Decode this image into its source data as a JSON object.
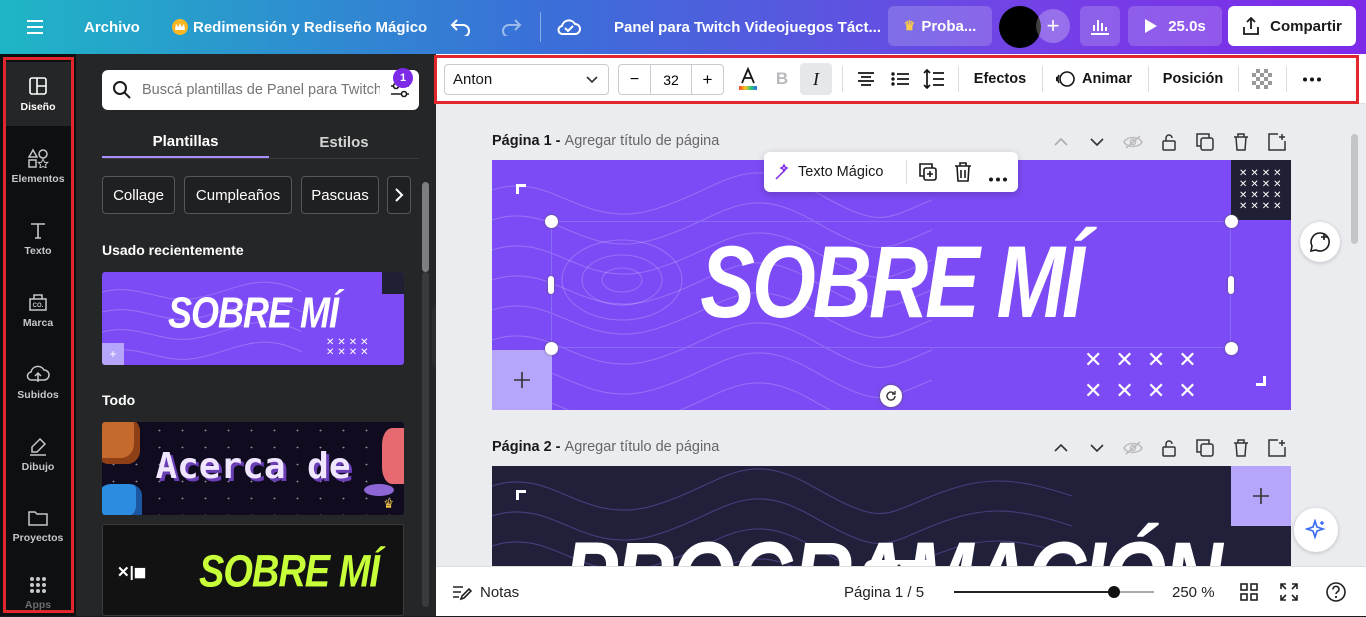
{
  "topbar": {
    "archivo": "Archivo",
    "magic_resize": "Redimensión y Rediseño Mágico",
    "doc_title": "Panel para Twitch Videojuegos Táct...",
    "try_label": "Proba...",
    "duration": "25.0s",
    "share": "Compartir"
  },
  "rail": {
    "items": [
      {
        "label": "Diseño"
      },
      {
        "label": "Elementos"
      },
      {
        "label": "Texto"
      },
      {
        "label": "Marca"
      },
      {
        "label": "Subidos"
      },
      {
        "label": "Dibujo"
      },
      {
        "label": "Proyectos"
      },
      {
        "label": "Apps"
      }
    ]
  },
  "panel": {
    "search_placeholder": "Buscá plantillas de Panel para Twitch",
    "badge": "1",
    "tabs": [
      "Plantillas",
      "Estilos"
    ],
    "chips": [
      "Collage",
      "Cumpleaños",
      "Pascuas"
    ],
    "recent_title": "Usado recientemente",
    "recent_thumb_text": "SOBRE MÍ",
    "all_title": "Todo",
    "thumb1_text": "Acerca de",
    "thumb2_text": "SOBRE MÍ",
    "thumb2_logo": "✕|◼"
  },
  "toolbar": {
    "font": "Anton",
    "size": "32",
    "minus": "−",
    "plus": "+",
    "bold": "B",
    "italic": "I",
    "effects": "Efectos",
    "animate": "Animar",
    "position": "Posición"
  },
  "canvas": {
    "page1": {
      "label": "Página 1 - ",
      "placeholder": "Agregar título de página",
      "headline": "SOBRE MÍ"
    },
    "page2": {
      "label": "Página 2 - ",
      "placeholder": "Agregar título de página",
      "headline": "PROGRAMACIÓN"
    },
    "float_toolbar": {
      "magic_text": "Texto Mágico"
    }
  },
  "bottombar": {
    "notes": "Notas",
    "page_counter": "Página 1 / 5",
    "zoom": "250 %",
    "zoom_fraction": 0.8
  },
  "colors": {
    "accent": "#7d2ae8",
    "page_purple": "#7c4bf5",
    "highlight_red": "#e3262b"
  }
}
